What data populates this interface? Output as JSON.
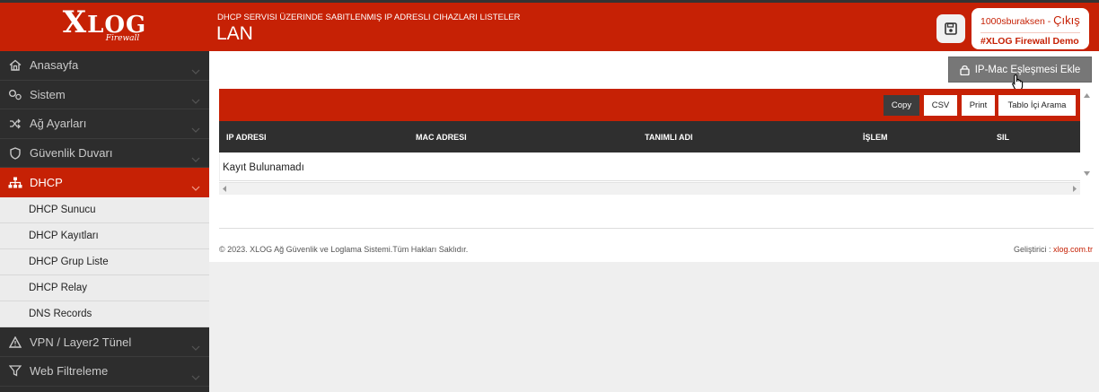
{
  "brand": {
    "logo_main_first": "X",
    "logo_main_rest": "LOG",
    "logo_sub": "Firewall"
  },
  "header": {
    "subtitle": "DHCP SERVISI ÜZERINDE SABITLENMIŞ IP ADRESLI CIHAZLARI LISTELER",
    "title": "LAN",
    "save_icon": "save-icon",
    "user": "1000sburaksen",
    "logout_sep": " - ",
    "logout": "Çıkış",
    "demo": "#XLOG Firewall Demo"
  },
  "sidebar": {
    "items": [
      {
        "label": "Anasayfa",
        "icon": "home-icon"
      },
      {
        "label": "Sistem",
        "icon": "gears-icon"
      },
      {
        "label": "Ağ Ayarları",
        "icon": "shuffle-icon"
      },
      {
        "label": "Güvenlik Duvarı",
        "icon": "shield-icon"
      },
      {
        "label": "DHCP",
        "icon": "sitemap-icon",
        "active": true
      },
      {
        "label": "VPN / Layer2 Tünel",
        "icon": "warning-icon"
      },
      {
        "label": "Web Filtreleme",
        "icon": "filter-icon"
      }
    ],
    "sub_items": [
      "DHCP Sunucu",
      "DHCP Kayıtları",
      "DHCP Grup Liste",
      "DHCP Relay",
      "DNS Records"
    ]
  },
  "main": {
    "add_button": "IP-Mac Eşleşmesi Ekle",
    "table_buttons": [
      "Copy",
      "CSV",
      "Print",
      "Tablo İçi Arama"
    ],
    "columns": [
      "IP ADRESI",
      "MAC ADRESI",
      "TANIMLI ADI",
      "İŞLEM",
      "SIL"
    ],
    "empty_text": "Kayıt Bulunamadı"
  },
  "footer": {
    "copyright": "© 2023. XLOG Ağ Güvenlik ve Loglama Sistemi.Tüm Hakları Saklıdır.",
    "dev_label": "Geliştirici : ",
    "dev_link": "xlog.com.tr"
  },
  "colors": {
    "accent": "#c62105",
    "sidebar": "#2d2d2d",
    "table_head": "#2f2f2f"
  }
}
